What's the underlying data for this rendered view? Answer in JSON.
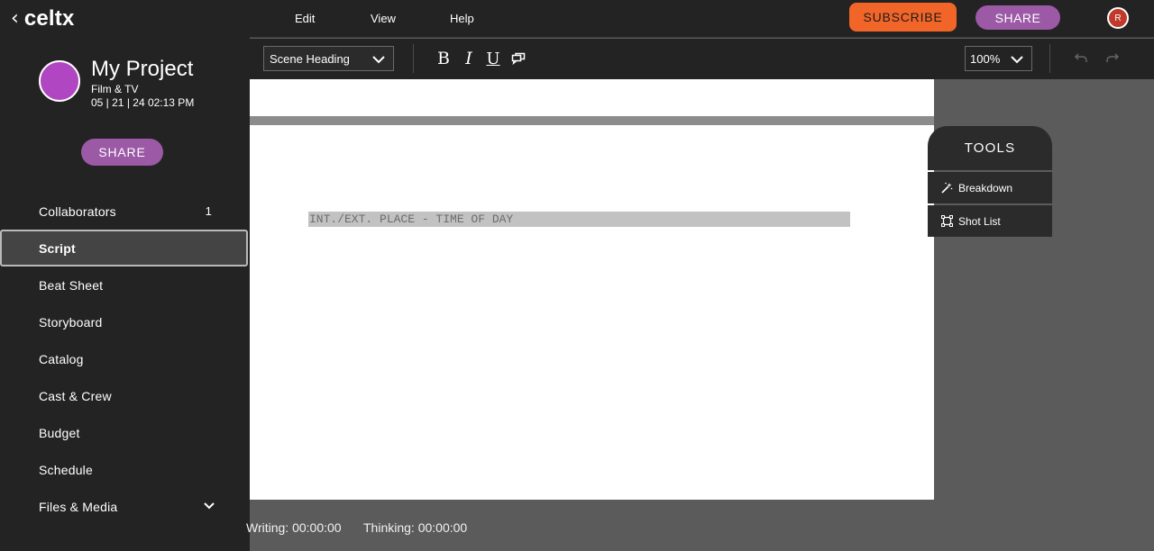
{
  "app": {
    "brand": "celtx",
    "back_glyph": "‹"
  },
  "project": {
    "title": "My Project",
    "type": "Film & TV",
    "date": "05 | 21 | 24 02:13 PM",
    "share_label": "SHARE",
    "avatar_color": "#b146c2"
  },
  "sidebar": {
    "items": [
      {
        "label": "Collaborators",
        "count": "1"
      },
      {
        "label": "Script",
        "active": true
      },
      {
        "label": "Beat Sheet"
      },
      {
        "label": "Storyboard"
      },
      {
        "label": "Catalog"
      },
      {
        "label": "Cast & Crew"
      },
      {
        "label": "Budget"
      },
      {
        "label": "Schedule"
      },
      {
        "label": "Files & Media",
        "icon": "chevron-down-icon"
      }
    ]
  },
  "topbar": {
    "menu": [
      "Edit",
      "View",
      "Help"
    ],
    "subscribe_label": "SUBSCRIBE",
    "share_label": "SHARE",
    "user_initial": "R",
    "colors": {
      "subscribe": "#f26528",
      "share": "#9b59a6",
      "avatar": "#c0392b"
    }
  },
  "toolbar": {
    "element_type": "Scene Heading",
    "format_buttons": {
      "bold": "B",
      "italic": "I",
      "underline": "U",
      "comment_icon": "comment-icon"
    },
    "zoom": "100%",
    "undo_icon": "undo-icon",
    "redo_icon": "redo-icon"
  },
  "editor": {
    "scene_heading": "INT./EXT. PLACE - TIME OF DAY"
  },
  "tools": {
    "title": "TOOLS",
    "items": [
      {
        "label": "Breakdown",
        "icon": "magic-wand-icon"
      },
      {
        "label": "Shot List",
        "icon": "frame-icon"
      }
    ]
  },
  "status": {
    "writing": "Writing: 00:00:00",
    "thinking": "Thinking: 00:00:00"
  }
}
